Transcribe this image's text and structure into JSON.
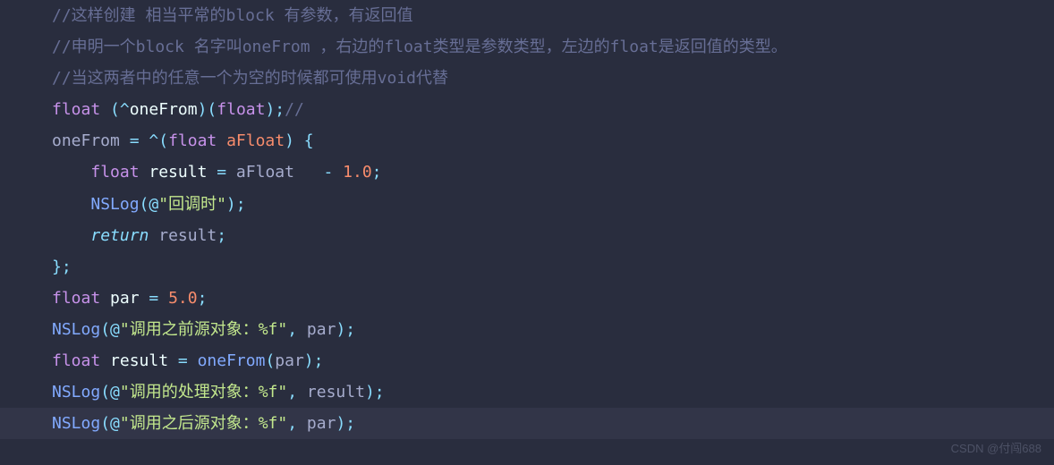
{
  "code": {
    "comment1": "//这样创建 相当平常的block 有参数，有返回值",
    "comment2": "//申明一个block 名字叫oneFrom ，右边的float类型是参数类型，左边的float是返回值的类型。",
    "comment3": "//当这两者中的任意一个为空的时候都可使用void代替",
    "line4": {
      "type1": "float",
      "caret": "^",
      "name": "oneFrom",
      "type2": "float",
      "punct1": "(",
      "punct2": ")(",
      "punct3": ");",
      "trail": "//"
    },
    "line5": {
      "name": "oneFrom",
      "eq": " = ",
      "caret": "^",
      "open": "(",
      "type": "float",
      "param": " aFloat",
      "close": ") {"
    },
    "line6": {
      "indent": "    ",
      "type": "float",
      "var": " result ",
      "eq": "=",
      "expr": " aFloat   ",
      "minus": "-",
      "sp": " ",
      "num": "1.0",
      "semi": ";"
    },
    "line7": {
      "indent": "    ",
      "fn": "NSLog",
      "open": "(",
      "at": "@",
      "str": "\"回调时\"",
      "close": ");"
    },
    "line8": {
      "indent": "    ",
      "ret": "return",
      "var": " result",
      "semi": ";"
    },
    "line9": "};",
    "line10": {
      "type": "float",
      "var": " par ",
      "eq": "=",
      "sp": " ",
      "num": "5.0",
      "semi": ";"
    },
    "line11": {
      "fn": "NSLog",
      "open": "(",
      "at": "@",
      "str": "\"调用之前源对象：%f\"",
      "comma": ",",
      "arg": " par",
      "close": ");"
    },
    "line12": {
      "type": "float",
      "var": " result ",
      "eq": "=",
      "sp": " ",
      "call": "oneFrom",
      "open": "(",
      "arg": "par",
      "close": ");"
    },
    "line13": {
      "fn": "NSLog",
      "open": "(",
      "at": "@",
      "str": "\"调用的处理对象：%f\"",
      "comma": ",",
      "arg": " result",
      "close": ");"
    },
    "line14": {
      "fn": "NSLog",
      "open": "(",
      "at": "@",
      "str": "\"调用之后源对象：%f\"",
      "comma": ",",
      "arg": " par",
      "close": ");"
    }
  },
  "watermark": "CSDN @付闯688"
}
